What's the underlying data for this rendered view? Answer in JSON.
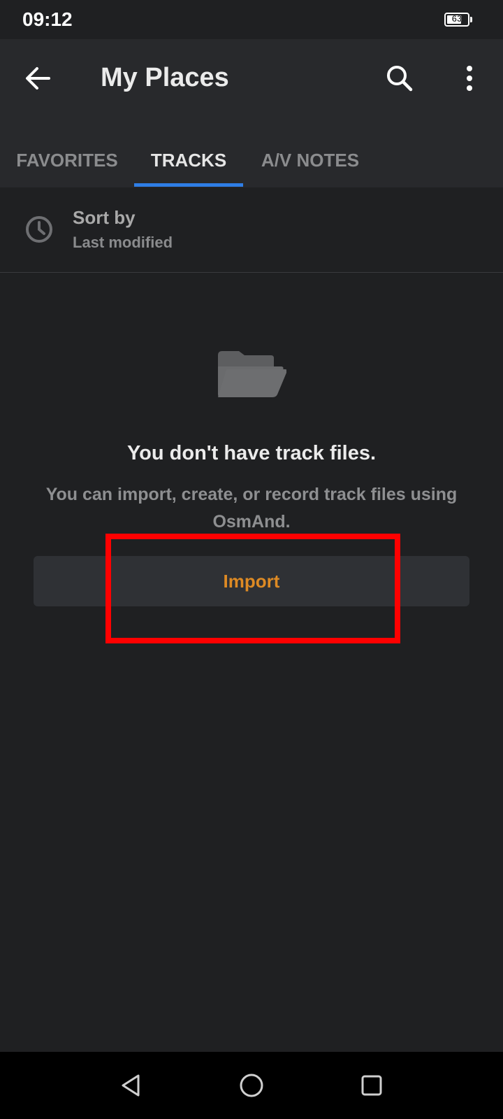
{
  "status_bar": {
    "time": "09:12",
    "battery_level": "63"
  },
  "header": {
    "title": "My Places",
    "icons": [
      "back-arrow-icon",
      "search-icon",
      "more-vertical-icon"
    ]
  },
  "tabs": [
    {
      "label": "FAVORITES",
      "active": false
    },
    {
      "label": "TRACKS",
      "active": true
    },
    {
      "label": "A/V NOTES",
      "active": false
    }
  ],
  "sort": {
    "title": "Sort by",
    "value": "Last modified"
  },
  "empty_state": {
    "icon": "folder-icon",
    "title": "You don't have track files.",
    "description": "You can import, create, or record track files using OsmAnd."
  },
  "import_button": {
    "label": "Import"
  },
  "colors": {
    "accent": "#dd8a24",
    "tab_indicator": "#2f7ee6",
    "highlight": "#ff0000",
    "background": "#1f2022"
  }
}
